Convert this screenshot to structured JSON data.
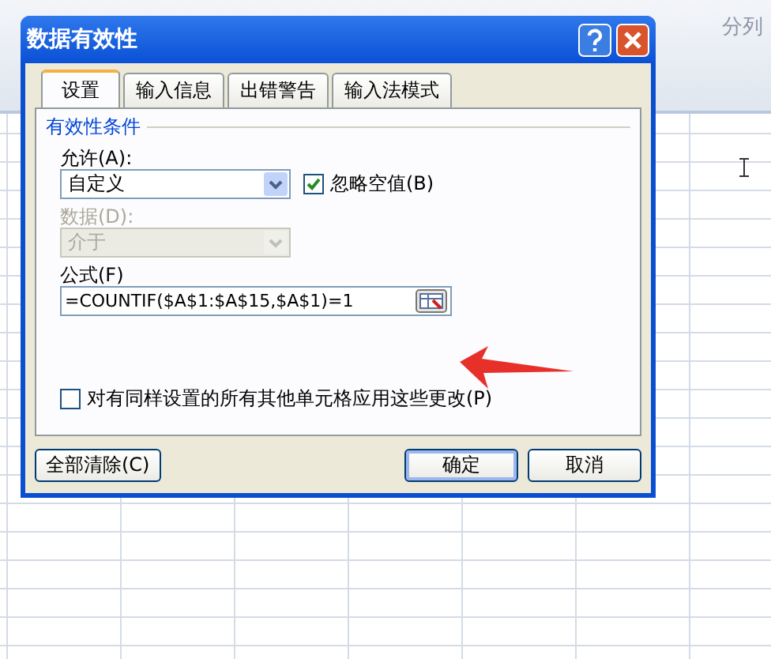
{
  "ribbon": {
    "labels": [
      {
        "text": "分列"
      }
    ]
  },
  "dialog": {
    "title": "数据有效性",
    "tabs": [
      {
        "label": "设置",
        "selected": true
      },
      {
        "label": "输入信息",
        "selected": false
      },
      {
        "label": "出错警告",
        "selected": false
      },
      {
        "label": "输入法模式",
        "selected": false
      }
    ],
    "section": "有效性条件",
    "allow": {
      "label": "允许(A):",
      "value": "自定义",
      "disabled": false
    },
    "ignore_blank": {
      "label": "忽略空值(B)",
      "checked": true
    },
    "data": {
      "label": "数据(D):",
      "value": "介于",
      "disabled": true
    },
    "formula": {
      "label": "公式(F)",
      "value": "=COUNTIF($A$1:$A$15,$A$1)=1"
    },
    "apply_all": {
      "label": "对有同样设置的所有其他单元格应用这些更改(P)",
      "checked": false
    },
    "buttons": [
      {
        "label": "全部清除(C)",
        "kind": "left"
      },
      {
        "label": "确定",
        "kind": "default"
      },
      {
        "label": "取消",
        "kind": "normal"
      }
    ]
  }
}
